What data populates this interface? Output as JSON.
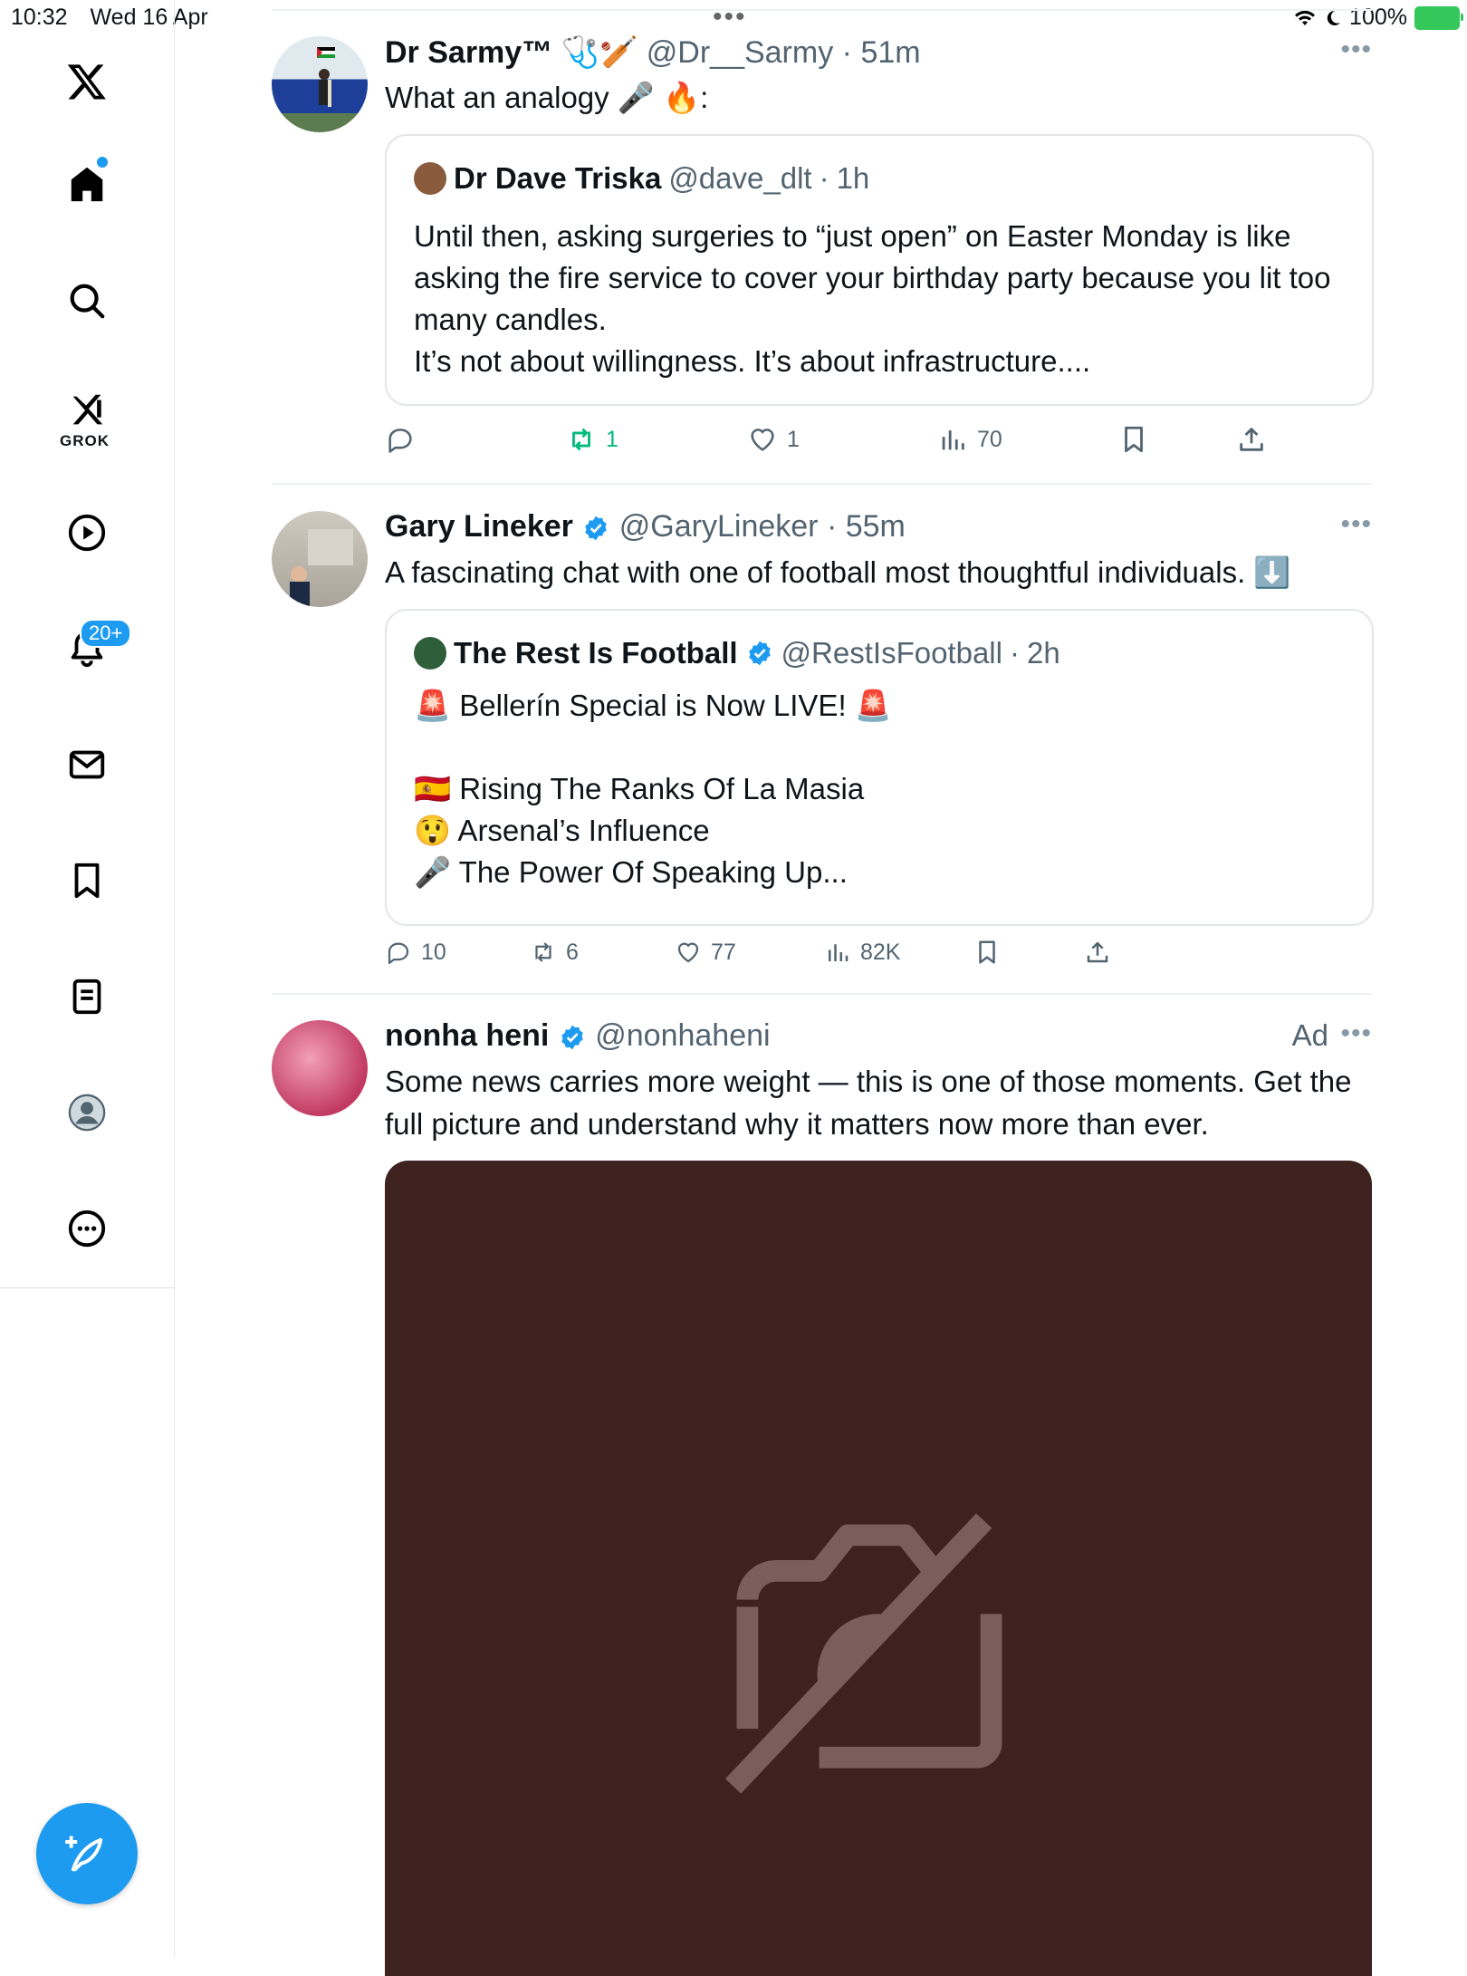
{
  "status": {
    "time": "10:32",
    "date": "Wed 16 Apr",
    "battery": "100%"
  },
  "sidebar": {
    "grok_label": "GROK",
    "notifications_badge": "20+"
  },
  "tweets": [
    {
      "name": "Dr Sarmy™ 🩺🏏",
      "handle": "@Dr__Sarmy",
      "time": "51m",
      "text": "What an analogy 🎤 🔥:",
      "quote": {
        "name": "Dr Dave Triska",
        "handle": "@dave_dlt",
        "time": "1h",
        "lines": [
          "Until then, asking surgeries to “just open” on Easter Monday is like asking the fire service to cover your birthday party because you lit too many candles.",
          "It’s not about willingness. It’s about infrastructure...."
        ]
      },
      "actions": {
        "replies": "",
        "reposts": "1",
        "likes": "1",
        "views": "70"
      }
    },
    {
      "name": "Gary Lineker",
      "handle": "@GaryLineker",
      "time": "55m",
      "text": "A fascinating chat with one of football most thoughtful individuals. ⬇️",
      "quote": {
        "name": "The Rest Is Football",
        "handle": "@RestIsFootball",
        "time": "2h",
        "lines": [
          "🚨 Bellerín Special is Now LIVE! 🚨",
          "",
          "🇪🇸 Rising The Ranks Of La Masia",
          "😲 Arsenal’s Influence",
          "🎤 The Power Of Speaking Up..."
        ]
      },
      "actions": {
        "replies": "10",
        "reposts": "6",
        "likes": "77",
        "views": "82K"
      }
    },
    {
      "name": "nonha heni",
      "handle": "@nonhaheni",
      "ad_label": "Ad",
      "text": "Some news carries more weight — this is one of those moments. Get the full picture and understand why it matters now more than ever."
    }
  ],
  "colors": {
    "accent": "#1d9bf0",
    "repost_active": "#00ba7c",
    "media_bg": "#3e2220"
  }
}
